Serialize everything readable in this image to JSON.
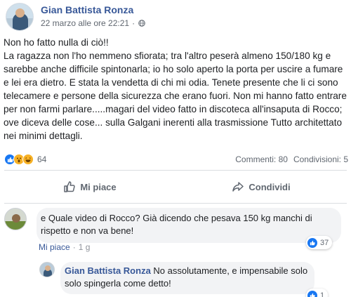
{
  "post": {
    "author": "Gian Battista Ronza",
    "timestamp": "22 marzo alle ore 22:21",
    "separator": "·",
    "text": "Non ho fatto nulla di ciò!!\nLa ragazza non l'ho nemmeno sfiorata; tra l'altro peserà almeno 150/180 kg e sarebbe anche difficile spintonarla; io ho solo aperto la porta per uscire a fumare e lei era dietro. E stata la vendetta di chi mi odia. Tenete presente che li ci sono telecamere e persone della sicurezza che erano fuori. Non mi hanno fatto entrare per non farmi parlare.....magari del video fatto in discoteca all'insaputa di Rocco; ove diceva delle cose... sulla Galgani inerenti alla trasmissione Tutto architettato nei minimi dettagli."
  },
  "reactions": {
    "count": "64",
    "types": [
      "like-icon",
      "wow-icon",
      "haha-icon"
    ],
    "comments_label": "Commenti: 80",
    "shares_label": "Condivisioni: 5"
  },
  "actions": {
    "like_label": "Mi piace",
    "share_label": "Condividi"
  },
  "comments": [
    {
      "author": "",
      "text": "e Quale video di Rocco? Già dicendo che pesava 150 kg manchi di rispetto e non va bene!",
      "like_action": "Mi piace",
      "time": "1 g",
      "likes": "37"
    },
    {
      "author": "Gian Battista Ronza",
      "text": "No assolutamente, e impensabile solo solo spingerla come detto!",
      "likes": "1"
    }
  ],
  "colors": {
    "accent": "#385898",
    "like_blue": "#1877f2",
    "secondary_text": "#606770",
    "bubble_bg": "#f2f3f5"
  }
}
